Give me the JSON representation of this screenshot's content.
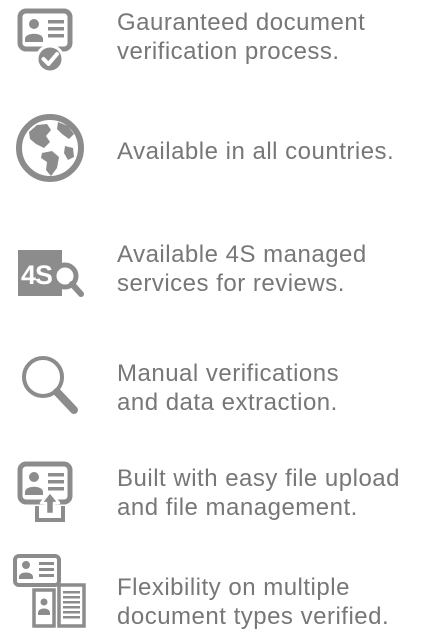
{
  "features": [
    {
      "icon": "id-card-verified-icon",
      "lines": [
        "Gauranteed document",
        "verification process."
      ]
    },
    {
      "icon": "globe-icon",
      "lines": [
        "Available in all countries."
      ]
    },
    {
      "icon": "4s-managed-services-icon",
      "lines": [
        "Available 4S managed",
        "services for reviews."
      ]
    },
    {
      "icon": "magnifier-icon",
      "lines": [
        "Manual verifications",
        "and data extraction."
      ]
    },
    {
      "icon": "id-card-upload-icon",
      "lines": [
        "Built with easy file upload",
        "and file management."
      ]
    },
    {
      "icon": "multiple-documents-icon",
      "lines": [
        "Flexibility on multiple",
        "document types verified."
      ]
    }
  ],
  "badge_text": "4S",
  "colors": {
    "icon": "#8c8c8c",
    "text": "#777777",
    "background": "#ffffff"
  }
}
